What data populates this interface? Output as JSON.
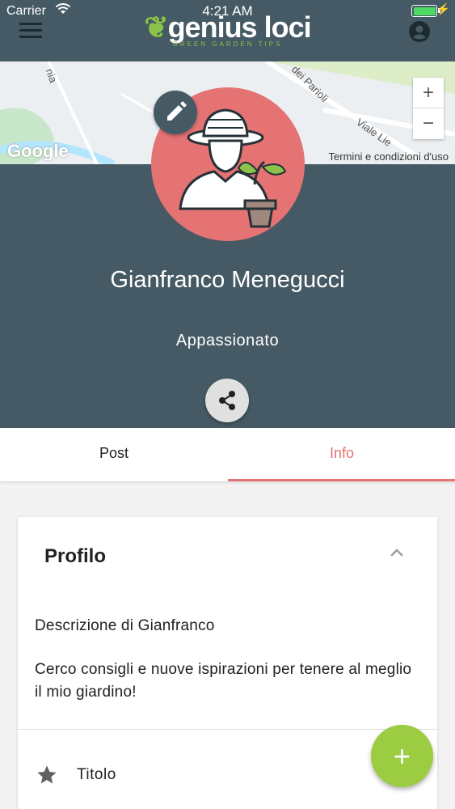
{
  "status_bar": {
    "carrier": "Carrier",
    "time": "4:21 AM"
  },
  "app": {
    "title_prefix": "genius",
    "title_suffix": "loci",
    "subtitle": "GREEN GARDEN TIPS",
    "brand_color": "#455a64",
    "accent_color": "#e57373",
    "fab_color": "#9ccc41"
  },
  "map": {
    "labels": [
      "nia",
      "dei Parioli",
      "Viale Lie"
    ],
    "attribution": "Google",
    "terms": "Termini e condizioni d'uso",
    "zoom_in": "+",
    "zoom_out": "−"
  },
  "profile": {
    "name": "Gianfranco Menegucci",
    "role": "Appassionato"
  },
  "tabs": [
    {
      "label": "Post",
      "active": false
    },
    {
      "label": "Info",
      "active": true
    }
  ],
  "card": {
    "title": "Profilo",
    "description_title": "Descrizione di Gianfranco",
    "description": "Cerco consigli e nuove ispirazioni per tenere al meglio il mio giardino!",
    "row_label": "Titolo"
  },
  "fab": {
    "label": "+"
  }
}
